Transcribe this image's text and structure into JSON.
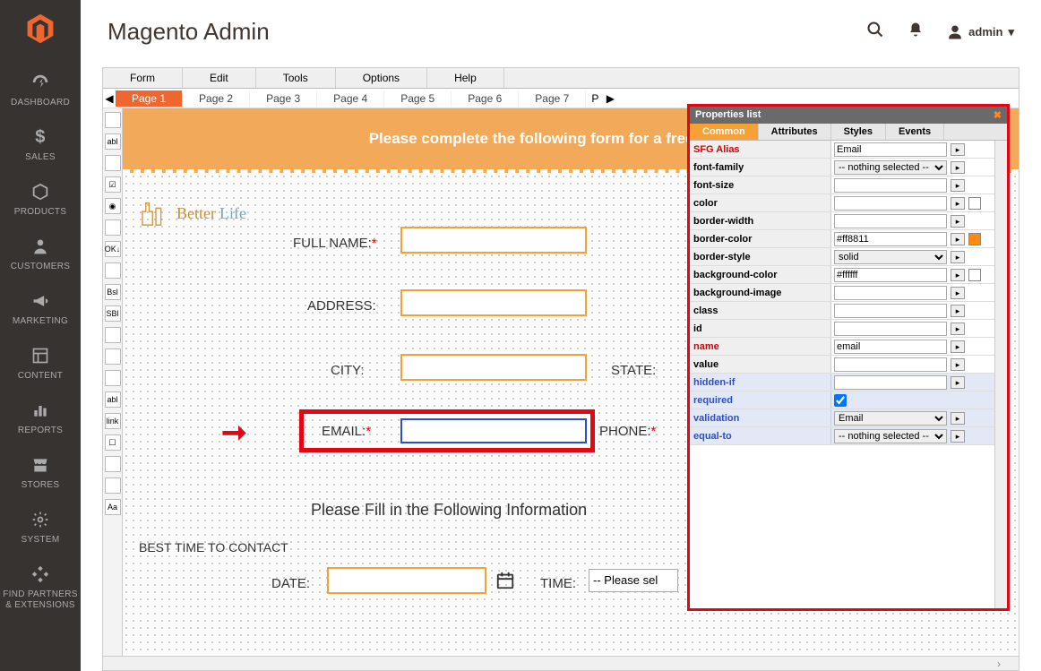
{
  "header": {
    "title": "Magento Admin",
    "user": "admin"
  },
  "sidebar": {
    "items": [
      {
        "icon": "dashboard",
        "label": "DASHBOARD"
      },
      {
        "icon": "sales",
        "label": "SALES"
      },
      {
        "icon": "products",
        "label": "PRODUCTS"
      },
      {
        "icon": "customers",
        "label": "CUSTOMERS"
      },
      {
        "icon": "marketing",
        "label": "MARKETING"
      },
      {
        "icon": "content",
        "label": "CONTENT"
      },
      {
        "icon": "reports",
        "label": "REPORTS"
      },
      {
        "icon": "stores",
        "label": "STORES"
      },
      {
        "icon": "system",
        "label": "SYSTEM"
      },
      {
        "icon": "partners",
        "label": "FIND PARTNERS & EXTENSIONS"
      }
    ]
  },
  "editor": {
    "menus": [
      "Form",
      "Edit",
      "Tools",
      "Options",
      "Help"
    ],
    "pages": [
      "Page 1",
      "Page 2",
      "Page 3",
      "Page 4",
      "Page 5",
      "Page 6",
      "Page 7"
    ],
    "active_page": 0,
    "banner": "Please complete the following form for a free kitchen ca",
    "logo": {
      "text1": "Better",
      "text2": "Life"
    },
    "fields": {
      "full_name": "FULL NAME:",
      "address": "ADDRESS:",
      "city": "CITY:",
      "state": "STATE:",
      "email": "EMAIL:",
      "phone": "PHONE:",
      "date": "DATE:",
      "time": "TIME:",
      "best_time": "BEST TIME TO CONTACT",
      "section_head": "Please Fill in the Following Information",
      "time_placeholder": "-- Please sel"
    }
  },
  "properties": {
    "title": "Properties list",
    "tabs": [
      "Common",
      "Attributes",
      "Styles",
      "Events"
    ],
    "active_tab": 0,
    "rows": [
      {
        "name": "SFG Alias",
        "kind": "text",
        "value": "Email",
        "red": true
      },
      {
        "name": "font-family",
        "kind": "select",
        "value": "-- nothing selected --"
      },
      {
        "name": "font-size",
        "kind": "text",
        "value": ""
      },
      {
        "name": "color",
        "kind": "color",
        "value": "",
        "swatch": "#ffffff"
      },
      {
        "name": "border-width",
        "kind": "text",
        "value": ""
      },
      {
        "name": "border-color",
        "kind": "color",
        "value": "#ff8811",
        "swatch": "#ff8811"
      },
      {
        "name": "border-style",
        "kind": "select",
        "value": "solid"
      },
      {
        "name": "background-color",
        "kind": "color",
        "value": "#ffffff",
        "swatch": "#ffffff"
      },
      {
        "name": "background-image",
        "kind": "text",
        "value": ""
      },
      {
        "name": "class",
        "kind": "text",
        "value": ""
      },
      {
        "name": "id",
        "kind": "text",
        "value": ""
      },
      {
        "name": "name",
        "kind": "text",
        "value": "email",
        "red": true
      },
      {
        "name": "value",
        "kind": "text",
        "value": ""
      },
      {
        "name": "hidden-if",
        "kind": "text",
        "value": "",
        "blue": true
      },
      {
        "name": "required",
        "kind": "check",
        "checked": true,
        "blue": true
      },
      {
        "name": "validation",
        "kind": "select",
        "value": "Email",
        "blue": true
      },
      {
        "name": "equal-to",
        "kind": "select",
        "value": "-- nothing selected --",
        "blue": true
      }
    ]
  },
  "tools": [
    "",
    "abl",
    "",
    "☑",
    "◉",
    "",
    "OK↓",
    "",
    "Bsl",
    "SBl",
    "",
    "",
    "",
    "abl",
    "link",
    "☐",
    "",
    "",
    "Aa"
  ]
}
